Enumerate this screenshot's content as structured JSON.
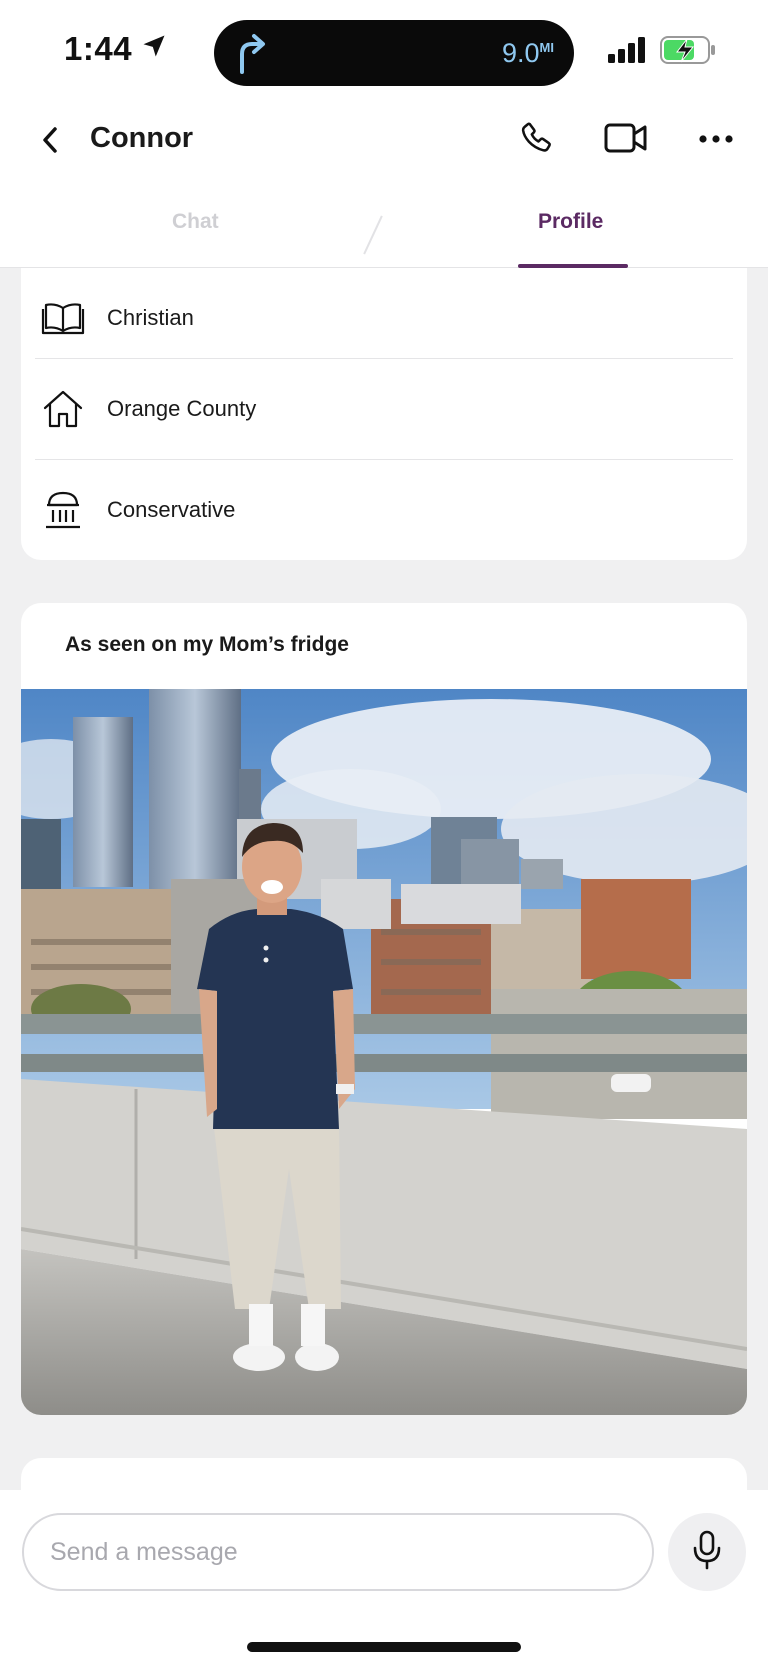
{
  "status_bar": {
    "time": "1:44",
    "island_distance": "9.0",
    "island_unit": "MI",
    "icons": [
      "location-arrow-icon",
      "turn-right-arrow-icon",
      "signal-icon",
      "battery-charging-icon"
    ]
  },
  "header": {
    "contact_name": "Connor",
    "icons": [
      "back-chevron-icon",
      "phone-icon",
      "video-camera-icon",
      "more-dots-icon"
    ]
  },
  "tabs": [
    {
      "label": "Chat",
      "active": false
    },
    {
      "label": "Profile",
      "active": true
    }
  ],
  "profile_info": [
    {
      "icon": "book-icon",
      "label": "Christian"
    },
    {
      "icon": "home-icon",
      "label": "Orange County"
    },
    {
      "icon": "government-building-icon",
      "label": "Conservative"
    }
  ],
  "photo_card": {
    "caption": "As seen on my Mom’s fridge"
  },
  "composer": {
    "placeholder": "Send a message",
    "value": "",
    "mic_icon": "microphone-icon"
  },
  "colors": {
    "accent": "#5b2a63",
    "background": "#f0f0f1",
    "inactive_tab": "#cfcfd3"
  }
}
